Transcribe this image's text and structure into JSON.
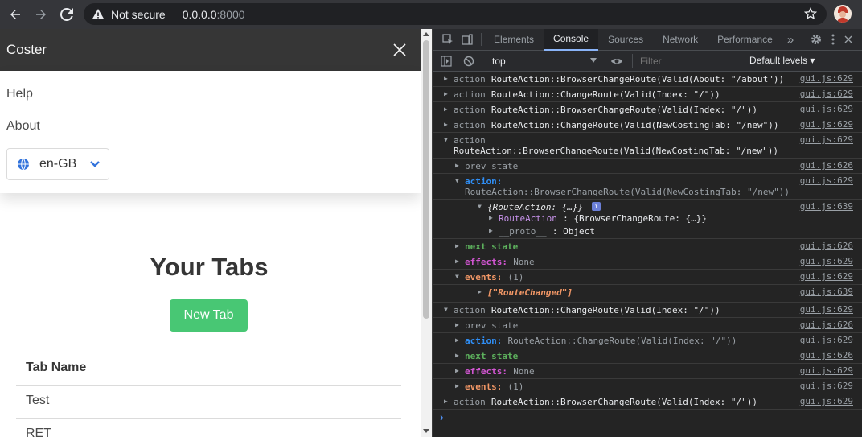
{
  "browser": {
    "security_label": "Not secure",
    "url_host": "0.0.0.0",
    "url_port": ":8000"
  },
  "app": {
    "brand": "Coster",
    "menu": {
      "help": "Help",
      "about": "About",
      "language": "en-GB"
    },
    "page_title": "Your Tabs",
    "new_tab_button": "New Tab",
    "table": {
      "header": "Tab Name",
      "rows": [
        "Test",
        "RET"
      ]
    }
  },
  "devtools": {
    "tabs": [
      "Elements",
      "Console",
      "Sources",
      "Network",
      "Performance"
    ],
    "more_tabs": "»",
    "context": "top",
    "filter_placeholder": "Filter",
    "levels": "Default levels ▾",
    "logs": [
      {
        "label": "action",
        "msg": "RouteAction::BrowserChangeRoute(Valid(About: \"/about\"))",
        "src": "gui.js:629"
      },
      {
        "label": "action",
        "msg": "RouteAction::ChangeRoute(Valid(Index: \"/\"))",
        "src": "gui.js:629"
      },
      {
        "label": "action",
        "msg": "RouteAction::BrowserChangeRoute(Valid(Index: \"/\"))",
        "src": "gui.js:629"
      },
      {
        "label": "action",
        "msg": "RouteAction::ChangeRoute(Valid(NewCostingTab: \"/new\"))",
        "src": "gui.js:629"
      },
      {
        "label": "action",
        "msg": "RouteAction::BrowserChangeRoute(Valid(NewCostingTab: \"/new\"))",
        "src": "gui.js:629"
      },
      {
        "label": "prev state",
        "src": "gui.js:626"
      },
      {
        "label": "action:",
        "msg": "RouteAction::BrowserChangeRoute(Valid(NewCostingTab: \"/new\"))",
        "src": "gui.js:629"
      },
      {
        "label": "{RouteAction: {…}}",
        "src": "gui.js:639"
      },
      {
        "label": "RouteAction",
        "msg": ": {BrowserChangeRoute: {…}}"
      },
      {
        "label": "__proto__",
        "msg": ": Object"
      },
      {
        "label": "next state",
        "src": "gui.js:626"
      },
      {
        "label": "effects:",
        "msg": "None",
        "src": "gui.js:629"
      },
      {
        "label": "events:",
        "msg": "(1)",
        "src": "gui.js:629"
      },
      {
        "label": "[\"RouteChanged\"]",
        "src": "gui.js:639"
      },
      {
        "label": "action",
        "msg": "RouteAction::ChangeRoute(Valid(Index: \"/\"))",
        "src": "gui.js:629"
      },
      {
        "label": "prev state",
        "src": "gui.js:626"
      },
      {
        "label": "action:",
        "msg": "RouteAction::ChangeRoute(Valid(Index: \"/\"))",
        "src": "gui.js:629"
      },
      {
        "label": "next state",
        "src": "gui.js:626"
      },
      {
        "label": "effects:",
        "msg": "None",
        "src": "gui.js:629"
      },
      {
        "label": "events:",
        "msg": "(1)",
        "src": "gui.js:629"
      },
      {
        "label": "action",
        "msg": "RouteAction::BrowserChangeRoute(Valid(Index: \"/\"))",
        "src": "gui.js:629"
      }
    ],
    "prompt": "›"
  }
}
